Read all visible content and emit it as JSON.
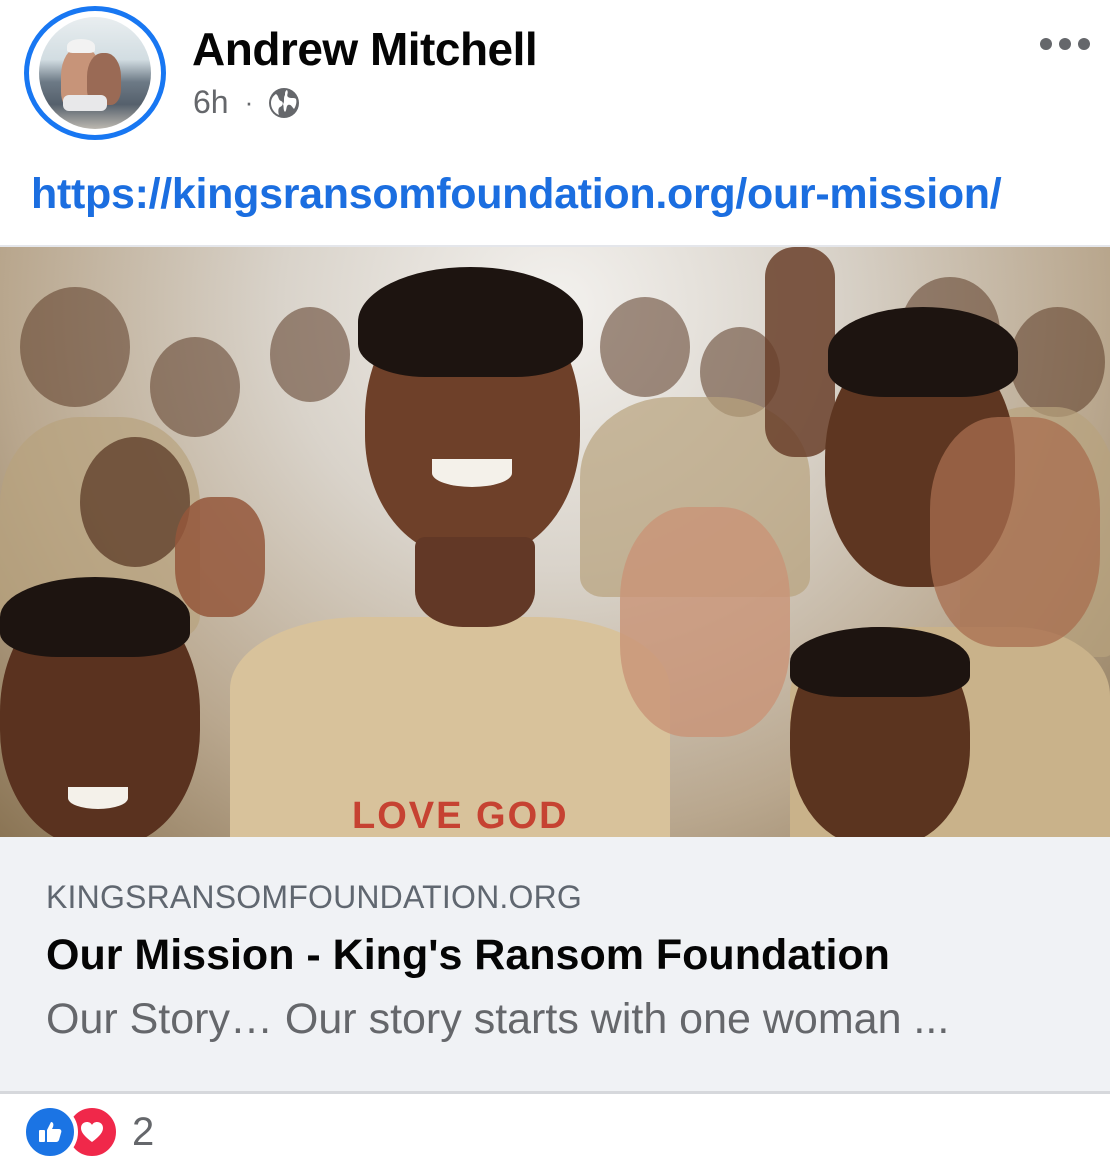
{
  "post": {
    "author": "Andrew Mitchell",
    "time": "6h",
    "separator": "·",
    "privacy_icon": "globe-icon",
    "menu_icon": "more-options-icon",
    "link": "https://kingsransomfoundation.org/our-mission/"
  },
  "link_preview": {
    "image_text": "LOVE GOD",
    "domain": "KINGSRANSOMFOUNDATION.ORG",
    "title": "Our Mission - King's Ransom Foundation",
    "description": "Our Story…   Our story starts with one woman ..."
  },
  "reactions": {
    "icons": [
      "like-icon",
      "love-icon"
    ],
    "count": "2"
  },
  "colors": {
    "accent": "#1877f2",
    "link": "#1b6ee0",
    "like": "#1b74e4",
    "love": "#f0284a",
    "card_bg": "#f0f2f5"
  }
}
